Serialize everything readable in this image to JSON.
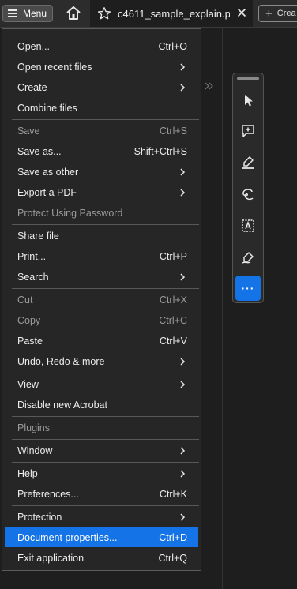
{
  "topbar": {
    "menu_label": "Menu",
    "tab_title": "c4611_sample_explain.p...",
    "create_label": "Crea"
  },
  "icons": {
    "menu": "hamburger-icon",
    "home": "home-icon",
    "star": "star-icon",
    "close": "close-icon",
    "create": "plus-icon",
    "chevron": "chevron-right-icon"
  },
  "colors": {
    "accent": "#1473e6",
    "menu_bg": "#262626",
    "app_bg": "#1e1e1e",
    "disabled_text": "#9a9a9a"
  },
  "menu": {
    "items": [
      {
        "label": "Open...",
        "shortcut": "Ctrl+O",
        "submenu": false,
        "disabled": false
      },
      {
        "label": "Open recent files",
        "shortcut": "",
        "submenu": true,
        "disabled": false
      },
      {
        "label": "Create",
        "shortcut": "",
        "submenu": true,
        "disabled": false
      },
      {
        "label": "Combine files",
        "shortcut": "",
        "submenu": false,
        "disabled": false
      },
      {
        "label": "Save",
        "shortcut": "Ctrl+S",
        "submenu": false,
        "disabled": true
      },
      {
        "label": "Save as...",
        "shortcut": "Shift+Ctrl+S",
        "submenu": false,
        "disabled": false
      },
      {
        "label": "Save as other",
        "shortcut": "",
        "submenu": true,
        "disabled": false
      },
      {
        "label": "Export a PDF",
        "shortcut": "",
        "submenu": true,
        "disabled": false
      },
      {
        "label": "Protect Using Password",
        "shortcut": "",
        "submenu": false,
        "disabled": true
      },
      {
        "label": "Share file",
        "shortcut": "",
        "submenu": false,
        "disabled": false
      },
      {
        "label": "Print...",
        "shortcut": "Ctrl+P",
        "submenu": false,
        "disabled": false
      },
      {
        "label": "Search",
        "shortcut": "",
        "submenu": true,
        "disabled": false
      },
      {
        "label": "Cut",
        "shortcut": "Ctrl+X",
        "submenu": false,
        "disabled": true
      },
      {
        "label": "Copy",
        "shortcut": "Ctrl+C",
        "submenu": false,
        "disabled": true
      },
      {
        "label": "Paste",
        "shortcut": "Ctrl+V",
        "submenu": false,
        "disabled": false
      },
      {
        "label": "Undo, Redo & more",
        "shortcut": "",
        "submenu": true,
        "disabled": false
      },
      {
        "label": "View",
        "shortcut": "",
        "submenu": true,
        "disabled": false
      },
      {
        "label": "Disable new Acrobat",
        "shortcut": "",
        "submenu": false,
        "disabled": false
      },
      {
        "label": "Plugins",
        "shortcut": "",
        "submenu": false,
        "disabled": true
      },
      {
        "label": "Window",
        "shortcut": "",
        "submenu": true,
        "disabled": false
      },
      {
        "label": "Help",
        "shortcut": "",
        "submenu": true,
        "disabled": false
      },
      {
        "label": "Preferences...",
        "shortcut": "Ctrl+K",
        "submenu": false,
        "disabled": false
      },
      {
        "label": "Protection",
        "shortcut": "",
        "submenu": true,
        "disabled": false
      },
      {
        "label": "Document properties...",
        "shortcut": "Ctrl+D",
        "submenu": false,
        "disabled": false,
        "highlighted": true
      },
      {
        "label": "Exit application",
        "shortcut": "Ctrl+Q",
        "submenu": false,
        "disabled": false
      }
    ]
  },
  "toolbar": {
    "tools": [
      {
        "icon": "select-cursor-icon",
        "active": false
      },
      {
        "icon": "add-comment-icon",
        "active": false
      },
      {
        "icon": "highlight-pen-icon",
        "active": false
      },
      {
        "icon": "freehand-draw-icon",
        "active": false
      },
      {
        "icon": "text-select-icon",
        "active": false
      },
      {
        "icon": "sign-icon",
        "active": false
      },
      {
        "icon": "more-tools-icon",
        "active": true
      }
    ]
  }
}
